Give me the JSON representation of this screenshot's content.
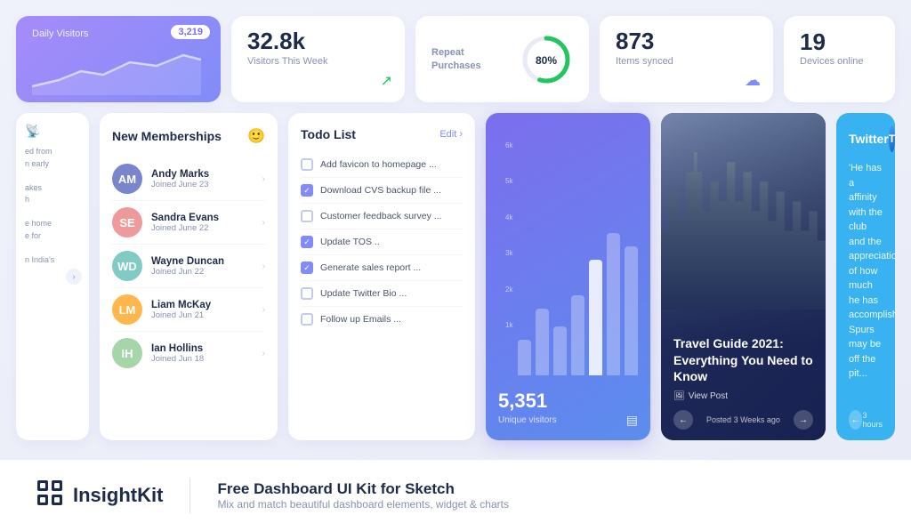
{
  "topCards": {
    "visitors": {
      "label": "Daily Visitors",
      "badge": "3,219"
    },
    "visitorsWeek": {
      "number": "32.8k",
      "label": "Visitors This Week"
    },
    "repeatPurchases": {
      "label": "Repeat\nPurchases",
      "percent": "80%"
    },
    "itemsSynced": {
      "number": "873",
      "label": "Items synced"
    },
    "devices": {
      "number": "19",
      "label": "Devices online"
    }
  },
  "memberships": {
    "title": "New Memberships",
    "members": [
      {
        "name": "Andy Marks",
        "date": "Joined June 23",
        "color": "#7986cb"
      },
      {
        "name": "Sandra Evans",
        "date": "Joined June 22",
        "color": "#ef9a9a"
      },
      {
        "name": "Wayne Duncan",
        "date": "Joined Jun 22",
        "color": "#80cbc4"
      },
      {
        "name": "Liam McKay",
        "date": "Joined Jun 21",
        "color": "#ffb74d"
      },
      {
        "name": "Ian Hollins",
        "date": "Joined Jun 18",
        "color": "#a5d6a7"
      }
    ]
  },
  "todo": {
    "title": "Todo List",
    "editLabel": "Edit ›",
    "items": [
      {
        "text": "Add favicon to homepage ...",
        "checked": false
      },
      {
        "text": "Download CVS backup file ...",
        "checked": true
      },
      {
        "text": "Customer feedback survey ...",
        "checked": false
      },
      {
        "text": "Update TOS ..",
        "checked": true
      },
      {
        "text": "Generate sales report ...",
        "checked": true
      },
      {
        "text": "Update Twitter Bio ...",
        "checked": false
      },
      {
        "text": "Follow up Emails ...",
        "checked": false
      }
    ]
  },
  "chart": {
    "number": "5,351",
    "label": "Unique visitors",
    "bars": [
      40,
      75,
      55,
      90,
      130,
      160,
      145
    ],
    "yLabels": [
      "6k",
      "5k",
      "4k",
      "3k",
      "2k",
      "1k"
    ]
  },
  "travel": {
    "title": "Travel Guide 2021: Everything You Need to Know",
    "viewPost": "View Post",
    "postedInfo": "Posted 3 Weeks ago"
  },
  "twitter": {
    "title": "Twitter",
    "text": "'He has a affinity with the club and the appreciation of how much he has accomplished. Spurs may be off the pit...",
    "timeAgo": "3 hours"
  },
  "branding": {
    "logoIcon": "⊞",
    "name": "InsightKit",
    "taglineMain": "Free Dashboard UI Kit for Sketch",
    "taglineSub": "Mix and match beautiful dashboard elements, widget & charts"
  },
  "articleCard": {
    "lines": [
      "ed from",
      "n early",
      "",
      "akes",
      "h",
      "",
      "e home",
      "e for",
      "",
      "n India's"
    ]
  }
}
